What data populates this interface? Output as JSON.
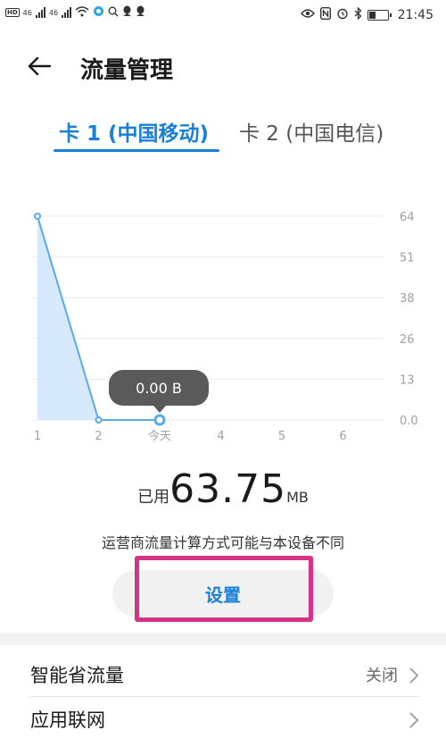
{
  "status_bar": {
    "left_labels": [
      "HD",
      "46",
      "46"
    ],
    "time": "21:45"
  },
  "header": {
    "title": "流量管理"
  },
  "tabs": [
    {
      "label": "卡 1 (中国移动)",
      "active": true
    },
    {
      "label": "卡 2 (中国电信)",
      "active": false
    }
  ],
  "chart_data": {
    "type": "area",
    "x_labels": [
      "1",
      "2",
      "今天",
      "4",
      "5",
      "6"
    ],
    "y_ticks": [
      "64",
      "51",
      "38",
      "26",
      "13",
      "0.0"
    ],
    "ylim": [
      0,
      64
    ],
    "series": [
      {
        "values": [
          64,
          0,
          0
        ]
      }
    ],
    "tooltip": "0.00 B",
    "colors": {
      "line": "#5aa9e6",
      "fill": "#cfe6fb",
      "tooltip_bg": "#5a5a5a"
    }
  },
  "usage": {
    "prefix": "已用",
    "value": "63.75",
    "unit": "MB"
  },
  "note": "运营商流量计算方式可能与本设备不同",
  "settings_button": "设置",
  "list": [
    {
      "label": "智能省流量",
      "value": "关闭"
    },
    {
      "label": "应用联网",
      "value": ""
    }
  ],
  "colors": {
    "accent": "#1a7fd6",
    "highlight": "#d63384"
  }
}
